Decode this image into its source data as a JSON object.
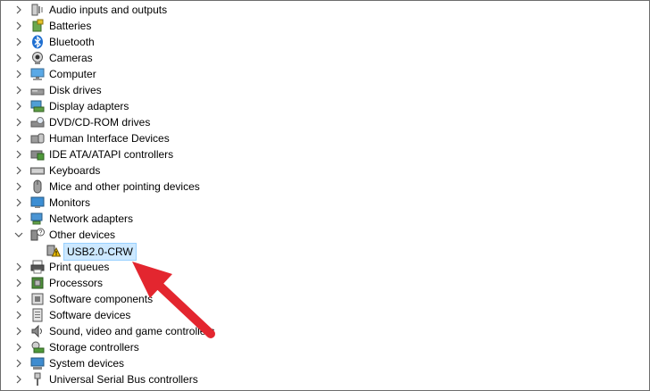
{
  "tree": {
    "items": [
      {
        "label": "Audio inputs and outputs",
        "icon": "speaker-icon"
      },
      {
        "label": "Batteries",
        "icon": "battery-icon"
      },
      {
        "label": "Bluetooth",
        "icon": "bluetooth-icon"
      },
      {
        "label": "Cameras",
        "icon": "camera-icon"
      },
      {
        "label": "Computer",
        "icon": "computer-icon"
      },
      {
        "label": "Disk drives",
        "icon": "disk-drive-icon"
      },
      {
        "label": "Display adapters",
        "icon": "display-adapter-icon"
      },
      {
        "label": "DVD/CD-ROM drives",
        "icon": "dvd-drive-icon"
      },
      {
        "label": "Human Interface Devices",
        "icon": "hid-icon"
      },
      {
        "label": "IDE ATA/ATAPI controllers",
        "icon": "ide-controller-icon"
      },
      {
        "label": "Keyboards",
        "icon": "keyboard-icon"
      },
      {
        "label": "Mice and other pointing devices",
        "icon": "mouse-icon"
      },
      {
        "label": "Monitors",
        "icon": "monitor-icon"
      },
      {
        "label": "Network adapters",
        "icon": "network-adapter-icon"
      },
      {
        "label": "Other devices",
        "icon": "unknown-device-icon",
        "expanded": true
      },
      {
        "label": "USB2.0-CRW",
        "icon": "warning-device-icon",
        "child": true,
        "selected": true
      },
      {
        "label": "Print queues",
        "icon": "printer-icon"
      },
      {
        "label": "Processors",
        "icon": "processor-icon"
      },
      {
        "label": "Software components",
        "icon": "software-component-icon"
      },
      {
        "label": "Software devices",
        "icon": "software-device-icon"
      },
      {
        "label": "Sound, video and game controllers",
        "icon": "sound-icon"
      },
      {
        "label": "Storage controllers",
        "icon": "storage-controller-icon"
      },
      {
        "label": "System devices",
        "icon": "system-device-icon"
      },
      {
        "label": "Universal Serial Bus controllers",
        "icon": "usb-icon"
      }
    ]
  },
  "annotation": {
    "arrow_color": "#e3262f"
  }
}
